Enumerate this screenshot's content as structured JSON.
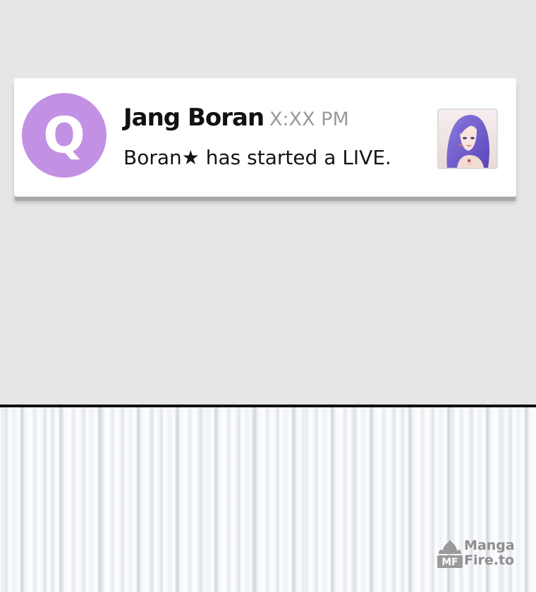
{
  "notification": {
    "app_icon_letter": "Q",
    "sender": "Jang Boran",
    "time": "X:XX PM",
    "message": "Boran★ has started a LIVE.",
    "thumbnail": "profile-thumbnail-woman-purple-hair"
  },
  "watermark": {
    "line1": "Manga",
    "line2": "Fire.to",
    "logo_letters": "MF"
  },
  "colors": {
    "app_icon": "#c291e3",
    "background_top": "#e6e6e6",
    "card": "#ffffff",
    "time_text": "#9a9a9a"
  }
}
